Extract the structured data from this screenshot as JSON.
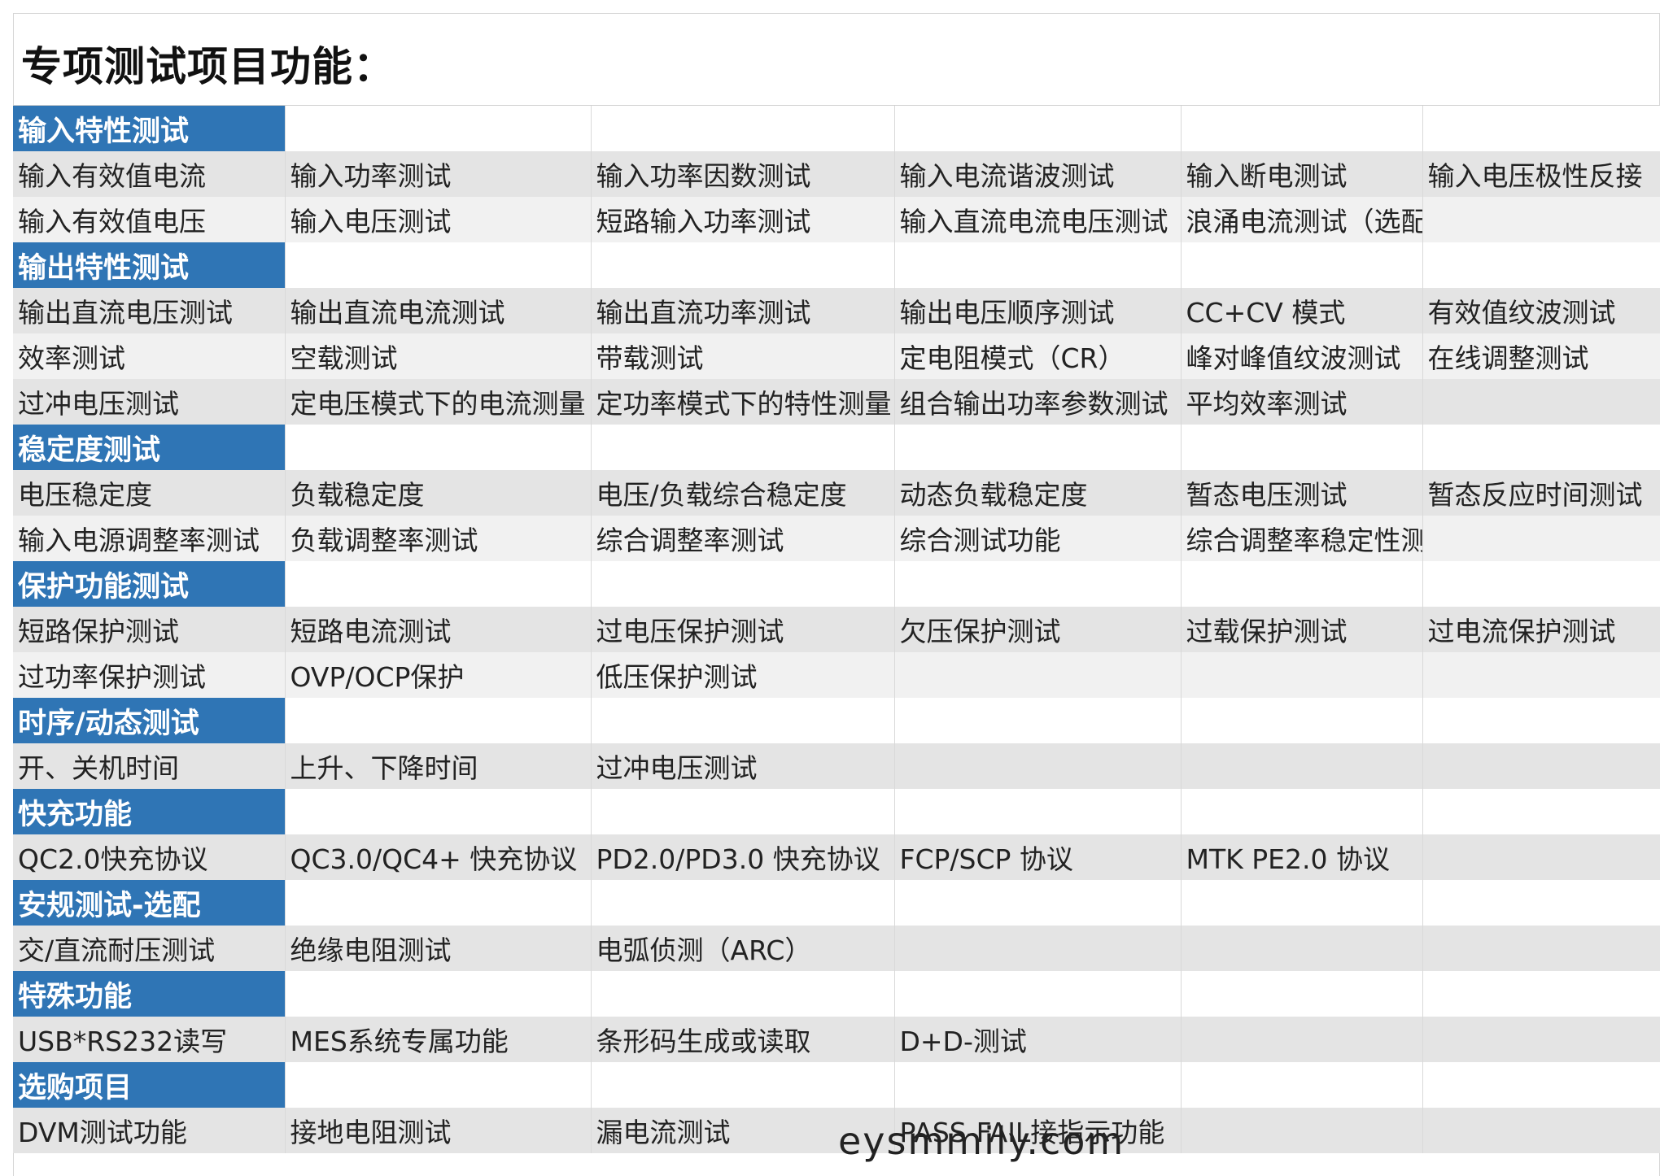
{
  "title": "专项测试项目功能：",
  "sections": [
    {
      "name": "输入特性测试",
      "rows": [
        [
          "输入有效值电流",
          "输入功率测试",
          "输入功率因数测试",
          "输入电流谐波测试",
          "输入断电测试",
          "输入电压极性反接"
        ],
        [
          "输入有效值电压",
          "输入电压测试",
          "短路输入功率测试",
          "输入直流电流电压测试",
          "浪涌电流测试（选配）",
          ""
        ]
      ]
    },
    {
      "name": "输出特性测试",
      "rows": [
        [
          "输出直流电压测试",
          "输出直流电流测试",
          "输出直流功率测试",
          "输出电压顺序测试",
          "CC+CV 模式",
          "有效值纹波测试"
        ],
        [
          "效率测试",
          "空载测试",
          "带载测试",
          "定电阻模式（CR）",
          "峰对峰值纹波测试",
          "在线调整测试"
        ],
        [
          "过冲电压测试",
          "定电压模式下的电流测量",
          "定功率模式下的特性测量",
          "组合输出功率参数测试",
          "平均效率测试",
          ""
        ]
      ]
    },
    {
      "name": "稳定度测试",
      "rows": [
        [
          "电压稳定度",
          "负载稳定度",
          "电压/负载综合稳定度",
          "动态负载稳定度",
          "暂态电压测试",
          "暂态反应时间测试"
        ],
        [
          "输入电源调整率测试",
          "负载调整率测试",
          "综合调整率测试",
          "综合测试功能",
          "综合调整率稳定性测试",
          ""
        ]
      ]
    },
    {
      "name": "保护功能测试",
      "rows": [
        [
          "短路保护测试",
          "短路电流测试",
          "过电压保护测试",
          "欠压保护测试",
          "过载保护测试",
          "过电流保护测试"
        ],
        [
          "过功率保护测试",
          "OVP/OCP保护",
          "低压保护测试",
          "",
          "",
          ""
        ]
      ]
    },
    {
      "name": "时序/动态测试",
      "rows": [
        [
          "开、关机时间",
          "上升、下降时间",
          "过冲电压测试",
          "",
          "",
          ""
        ]
      ]
    },
    {
      "name": "快充功能",
      "rows": [
        [
          "QC2.0快充协议",
          "QC3.0/QC4+ 快充协议",
          "PD2.0/PD3.0 快充协议",
          "FCP/SCP 协议",
          "MTK PE2.0 协议",
          ""
        ]
      ]
    },
    {
      "name": "安规测试-选配",
      "rows": [
        [
          "交/直流耐压测试",
          "绝缘电阻测试",
          "电弧侦测（ARC）",
          "",
          "",
          ""
        ]
      ]
    },
    {
      "name": "特殊功能",
      "rows": [
        [
          "USB*RS232读写",
          "MES系统专属功能",
          "条形码生成或读取",
          "D+D-测试",
          "",
          ""
        ]
      ]
    },
    {
      "name": "选购项目",
      "rows": [
        [
          "DVM测试功能",
          "接地电阻测试",
          "漏电流测试",
          "PASS-FAIL接指示功能",
          "",
          ""
        ]
      ]
    }
  ],
  "watermark": "eysmmily.com",
  "colors": {
    "section_header_bg": "#2f75b5",
    "row_shade_a": "#e4e4e4",
    "row_shade_b": "#f1f1f1"
  }
}
